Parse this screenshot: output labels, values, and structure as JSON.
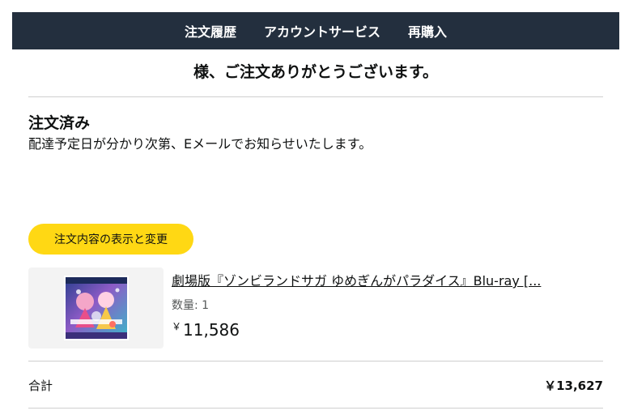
{
  "nav": {
    "items": [
      {
        "label": "注文履歴"
      },
      {
        "label": "アカウントサービス"
      },
      {
        "label": "再購入"
      }
    ]
  },
  "greeting": "様、ご注文ありがとうございます。",
  "order_status": {
    "title": "注文済み",
    "description": "配達予定日が分かり次第、Eメールでお知らせいたします。"
  },
  "view_order_button": "注文内容の表示と変更",
  "product": {
    "title": "劇場版『ゾンビランドサガ ゆめぎんがパラダイス』Blu-ray [...",
    "quantity_label": "数量: 1",
    "currency_symbol": "￥",
    "price": "11,586"
  },
  "summary": {
    "total_label": "合計",
    "total_value": "￥13,627"
  },
  "colors": {
    "navbar": "#232f3e",
    "button": "#ffd814"
  }
}
